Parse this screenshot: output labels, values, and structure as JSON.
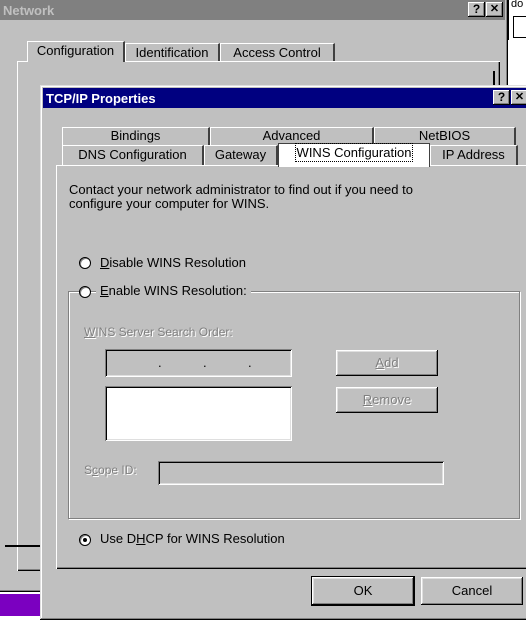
{
  "network_window": {
    "title": "Network",
    "help_button": "?",
    "close_button": "✕",
    "tabs": [
      "Configuration",
      "Identification",
      "Access Control"
    ]
  },
  "background_fragment": "do",
  "tcpip_window": {
    "title": "TCP/IP Properties",
    "help_button": "?",
    "close_button": "✕",
    "tabs_row1": [
      "Bindings",
      "Advanced",
      "NetBIOS"
    ],
    "tabs_row2": [
      "DNS Configuration",
      "Gateway",
      "WINS Configuration",
      "IP Address"
    ],
    "selected_tab": "WINS Configuration",
    "description_line1": "Contact your network administrator to find out if you need to",
    "description_line2": "configure your computer for WINS.",
    "disable_label": {
      "accel": "D",
      "rest": "isable WINS Resolution"
    },
    "enable_label": {
      "accel": "E",
      "rest": "nable WINS Resolution:"
    },
    "server_order_label": {
      "accel": "W",
      "rest": "INS Server Search Order:"
    },
    "add_button": {
      "accel": "A",
      "rest": "dd"
    },
    "remove_button": {
      "accel": "R",
      "rest": "emove"
    },
    "scope_label": {
      "pre": "S",
      "accel": "c",
      "rest": "ope ID:"
    },
    "dhcp_label": {
      "pre": "Use D",
      "accel": "H",
      "rest": "CP for WINS Resolution"
    },
    "selected_option": "Use DHCP for WINS Resolution",
    "ok_button": "OK",
    "cancel_button": "Cancel"
  }
}
